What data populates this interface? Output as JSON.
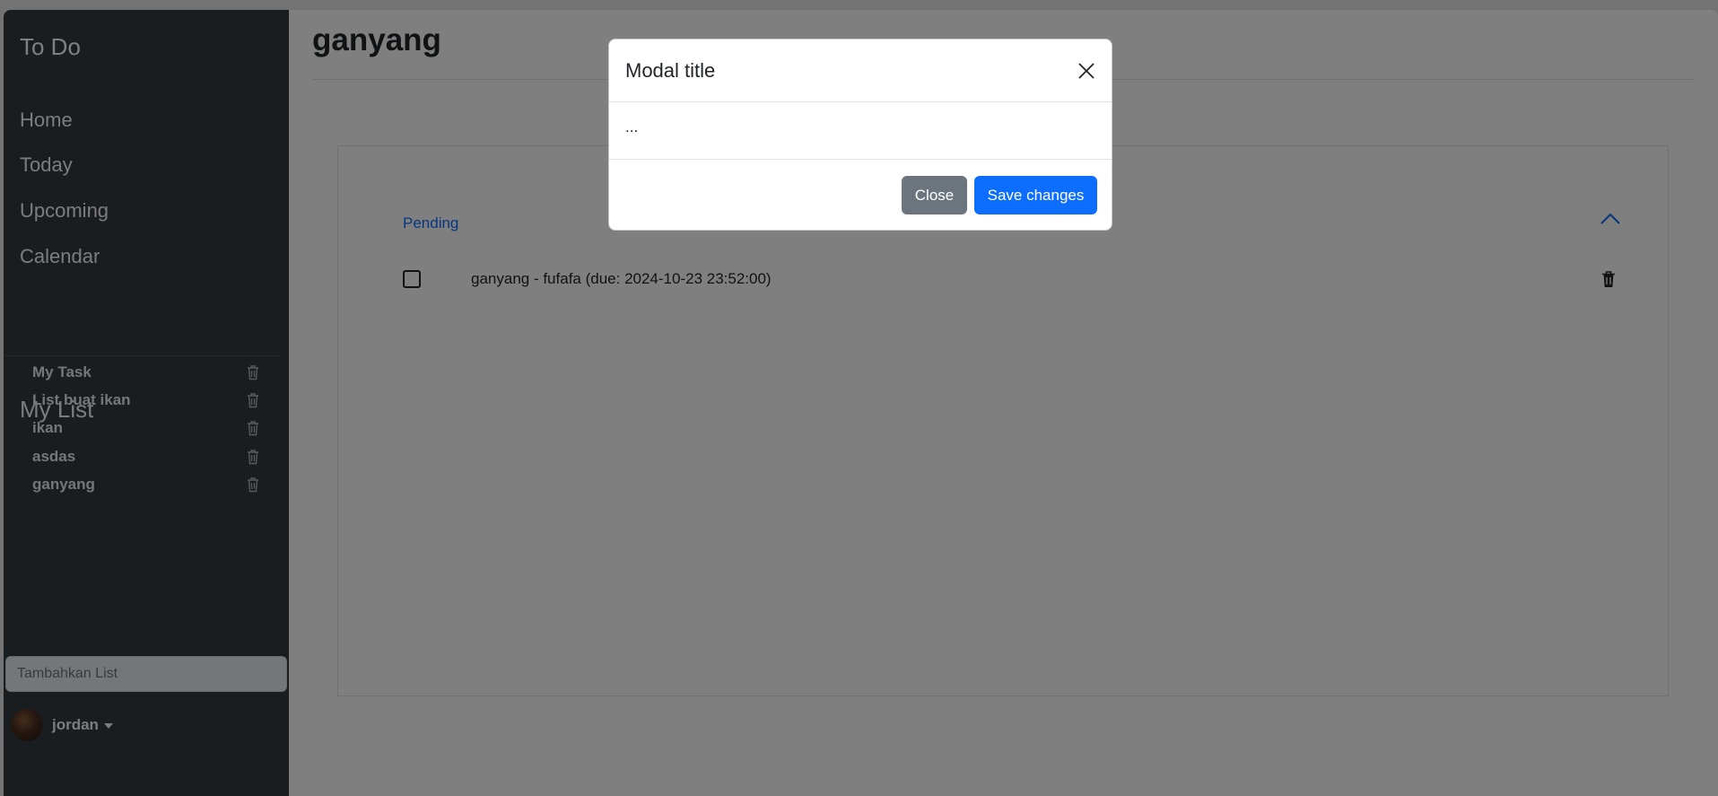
{
  "sidebar": {
    "brand": "To Do",
    "nav": [
      {
        "label": "Home"
      },
      {
        "label": "Today"
      },
      {
        "label": "Upcoming"
      },
      {
        "label": "Calendar"
      }
    ],
    "my_list_title": "My List",
    "lists": [
      {
        "label": "My Task"
      },
      {
        "label": "List buat ikan"
      },
      {
        "label": "ikan"
      },
      {
        "label": "asdas"
      },
      {
        "label": "ganyang"
      }
    ],
    "add_list_placeholder": "Tambahkan List",
    "user": {
      "name": "jordan"
    }
  },
  "main": {
    "title": "ganyang",
    "section_label": "Pending",
    "tasks": [
      {
        "text": "ganyang - fufafa (due: 2024-10-23 23:52:00)",
        "checked": false
      }
    ]
  },
  "modal": {
    "title": "Modal title",
    "body": "...",
    "close_label": "Close",
    "save_label": "Save changes"
  },
  "icons": {
    "trash": "trash-icon",
    "chevron": "chevron-up-icon",
    "close": "close-icon"
  },
  "colors": {
    "sidebar_bg": "#343a40",
    "primary": "#0d6efd",
    "secondary": "#6c757d"
  }
}
